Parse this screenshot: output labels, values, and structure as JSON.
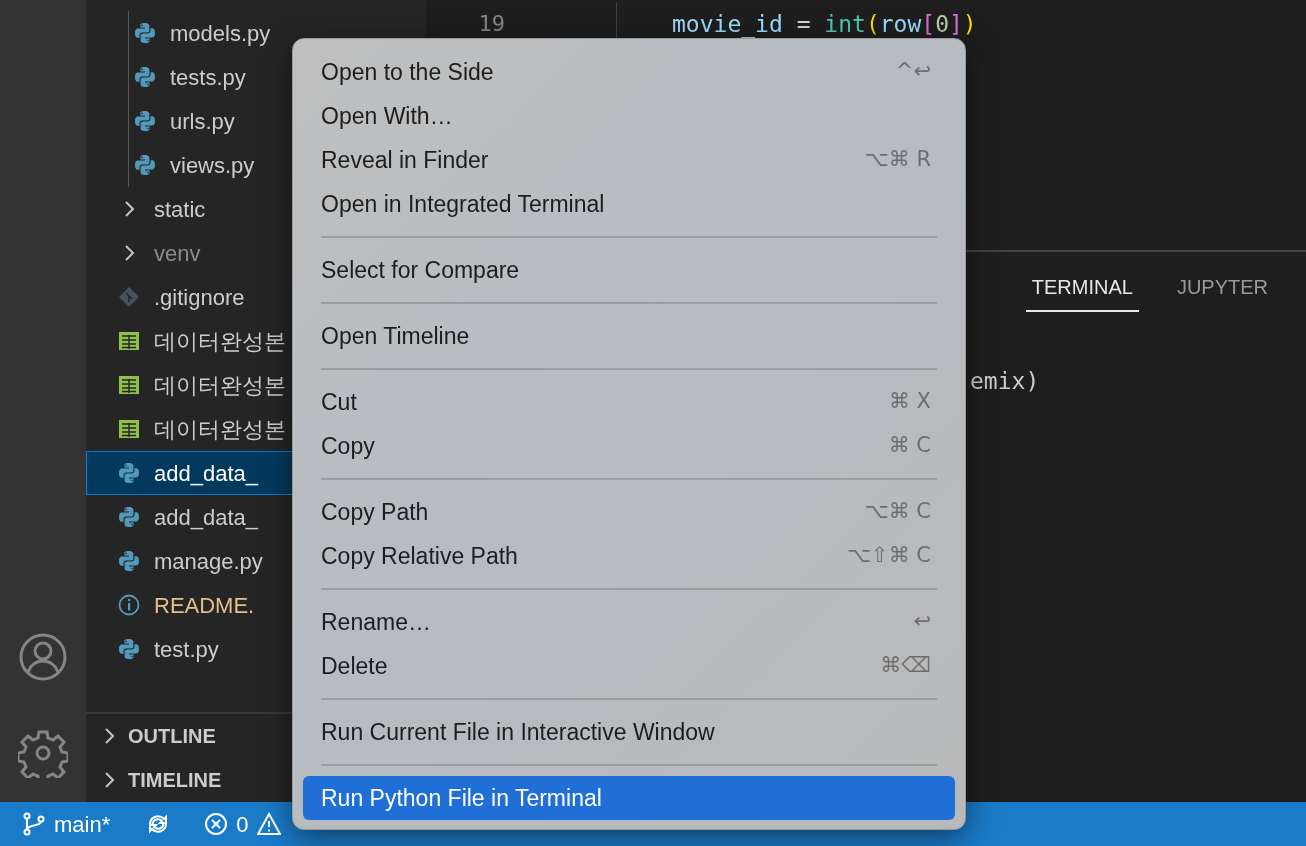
{
  "explorer": {
    "tree": [
      {
        "children": [
          {
            "label": "models.py",
            "kind": "python",
            "selected": false,
            "dimmed": false,
            "modified": false
          },
          {
            "label": "tests.py",
            "kind": "python",
            "selected": false,
            "dimmed": false,
            "modified": false
          },
          {
            "label": "urls.py",
            "kind": "python",
            "selected": false,
            "dimmed": false,
            "modified": false
          },
          {
            "label": "views.py",
            "kind": "python",
            "selected": false,
            "dimmed": false,
            "modified": false
          }
        ]
      },
      {
        "label": "static",
        "kind": "folder",
        "expanded": false,
        "selected": false,
        "dimmed": false,
        "modified": false
      },
      {
        "label": "venv",
        "kind": "folder",
        "expanded": false,
        "selected": false,
        "dimmed": true,
        "modified": false
      },
      {
        "label": ".gitignore",
        "kind": "git",
        "selected": false,
        "dimmed": false,
        "modified": false
      },
      {
        "label": "데이터완성본",
        "kind": "sheet",
        "selected": false,
        "dimmed": false,
        "modified": false
      },
      {
        "label": "데이터완성본",
        "kind": "sheet",
        "selected": false,
        "dimmed": false,
        "modified": false
      },
      {
        "label": "데이터완성본",
        "kind": "sheet",
        "selected": false,
        "dimmed": false,
        "modified": false
      },
      {
        "label": "add_data_",
        "kind": "python",
        "selected": true,
        "dimmed": false,
        "modified": false
      },
      {
        "label": "add_data_",
        "kind": "python",
        "selected": false,
        "dimmed": false,
        "modified": false
      },
      {
        "label": "manage.py",
        "kind": "python",
        "selected": false,
        "dimmed": false,
        "modified": false
      },
      {
        "label": "README.",
        "kind": "info",
        "selected": false,
        "dimmed": false,
        "modified": true
      },
      {
        "label": "test.py",
        "kind": "python",
        "selected": false,
        "dimmed": false,
        "modified": false
      }
    ],
    "sections": [
      {
        "label": "OUTLINE",
        "expanded": false
      },
      {
        "label": "TIMELINE",
        "expanded": false
      }
    ]
  },
  "editor": {
    "line_number": "19",
    "code": [
      {
        "text": "movie_id",
        "kind": "variable"
      },
      {
        "text": " = ",
        "kind": "operator"
      },
      {
        "text": "int",
        "kind": "function"
      },
      {
        "text": "(",
        "kind": "paren"
      },
      {
        "text": "row",
        "kind": "variable"
      },
      {
        "text": "[",
        "kind": "bracket"
      },
      {
        "text": "0",
        "kind": "number"
      },
      {
        "text": "]",
        "kind": "bracket"
      },
      {
        "text": ")",
        "kind": "paren"
      }
    ]
  },
  "panel": {
    "tabs": [
      {
        "label": "TERMINAL",
        "selected": true
      },
      {
        "label": "JUPYTER",
        "selected": false
      }
    ],
    "terminal_lines": [
      "emix)"
    ]
  },
  "context_menu": {
    "groups": [
      [
        {
          "label": "Open to the Side",
          "shortcut": "^↩",
          "selected": false
        },
        {
          "label": "Open With…",
          "selected": false
        },
        {
          "label": "Reveal in Finder",
          "shortcut": "⌥⌘ R",
          "selected": false
        },
        {
          "label": "Open in Integrated Terminal",
          "selected": false
        }
      ],
      [
        {
          "label": "Select for Compare",
          "selected": false
        }
      ],
      [
        {
          "label": "Open Timeline",
          "selected": false
        }
      ],
      [
        {
          "label": "Cut",
          "shortcut": "⌘ X",
          "selected": false
        },
        {
          "label": "Copy",
          "shortcut": "⌘ C",
          "selected": false
        }
      ],
      [
        {
          "label": "Copy Path",
          "shortcut": "⌥⌘ C",
          "selected": false
        },
        {
          "label": "Copy Relative Path",
          "shortcut": "⌥⇧⌘ C",
          "selected": false
        }
      ],
      [
        {
          "label": "Rename…",
          "shortcut": "↩",
          "selected": false
        },
        {
          "label": "Delete",
          "shortcut": "⌘⌫",
          "selected": false
        }
      ],
      [
        {
          "label": "Run Current File in Interactive Window",
          "selected": false
        }
      ],
      [
        {
          "label": "Run Python File in Terminal",
          "selected": true
        }
      ]
    ]
  },
  "status_bar": {
    "branch": "main*",
    "errors": "0"
  }
}
